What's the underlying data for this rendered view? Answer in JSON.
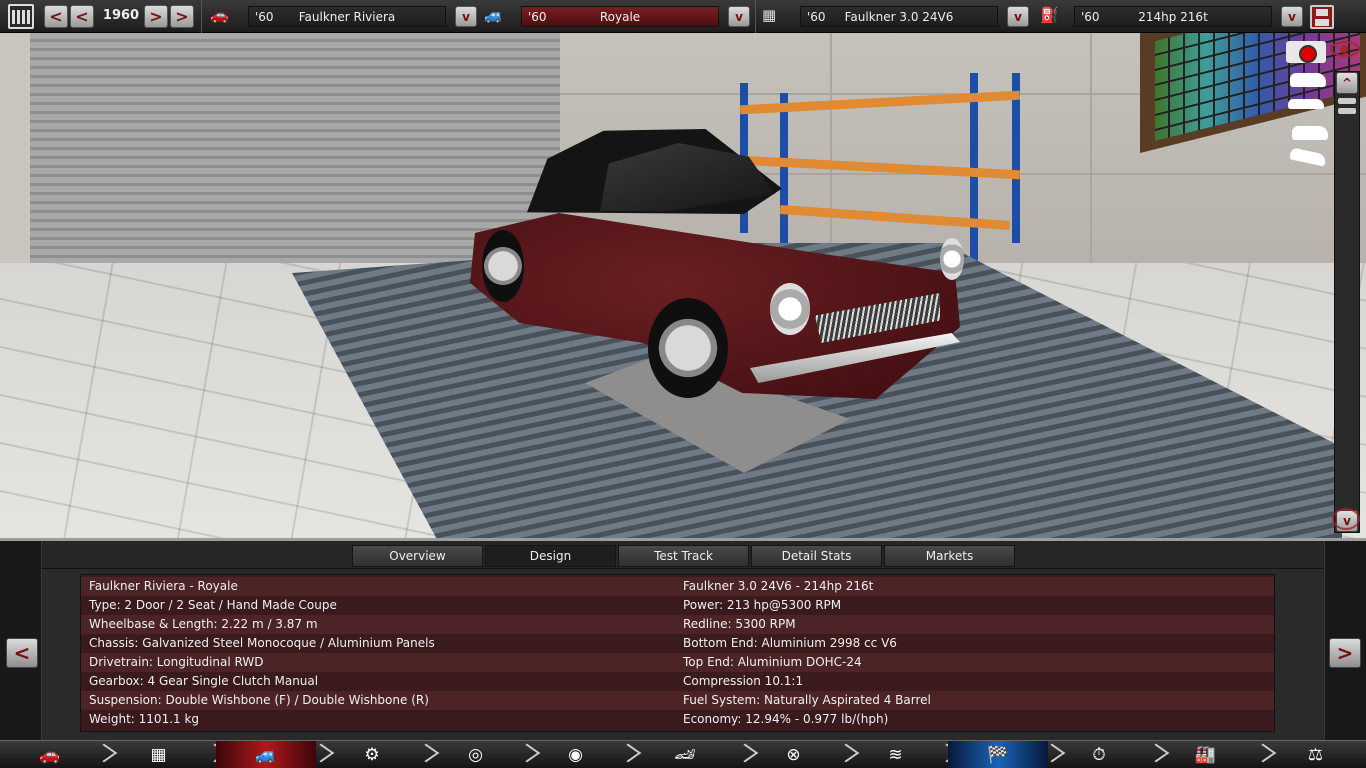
{
  "top": {
    "year": "1960",
    "prev2_label": "<",
    "prev_label": "<",
    "next_label": ">",
    "next2_label": ">",
    "dropdown_label": "v",
    "model": {
      "year": "'60",
      "name": "Faulkner Riviera"
    },
    "trim": {
      "year": "'60",
      "name": "Royale"
    },
    "engine_family": {
      "year": "'60",
      "name": "Faulkner 3.0 24V6"
    },
    "engine_variant": {
      "year": "'60",
      "name": "214hp 216t"
    }
  },
  "tabs": [
    {
      "label": "Overview"
    },
    {
      "label": "Design"
    },
    {
      "label": "Test Track"
    },
    {
      "label": "Detail Stats"
    },
    {
      "label": "Markets"
    }
  ],
  "active_tab": "Design",
  "page_prev_label": "<",
  "page_next_label": ">",
  "scroll": {
    "up": "^",
    "down": "v"
  },
  "info": {
    "left": [
      "Faulkner Riviera  - Royale",
      "Type: 2 Door / 2 Seat / Hand Made Coupe",
      "Wheelbase & Length: 2.22 m / 3.87 m",
      "Chassis: Galvanized Steel Monocoque / Aluminium Panels",
      "Drivetrain: Longitudinal RWD",
      "Gearbox: 4 Gear Single Clutch Manual",
      "Suspension: Double Wishbone (F) / Double Wishbone (R)",
      "Weight: 1101.1 kg"
    ],
    "right": [
      "Faulkner 3.0 24V6 - 214hp 216t",
      "Power: 213 hp@5300 RPM",
      "Redline: 5300 RPM",
      "Bottom End: Aluminium 2998 cc V6",
      "Top End: Aluminium DOHC-24",
      "Compression 10.1:1",
      "Fuel System: Naturally Aspirated 4 Barrel",
      "Economy: 12.94% - 0.977 lb/(hph)"
    ]
  },
  "nav": [
    {
      "name": "car-model-icon",
      "glyph": "🚗"
    },
    {
      "name": "chassis-icon",
      "glyph": "▦"
    },
    {
      "name": "trim-icon",
      "glyph": "🚙"
    },
    {
      "name": "gearbox-icon",
      "glyph": "⚙"
    },
    {
      "name": "wheels-icon",
      "glyph": "◎"
    },
    {
      "name": "body-icon",
      "glyph": "◉"
    },
    {
      "name": "aero-icon",
      "glyph": "🏎"
    },
    {
      "name": "interior-icon",
      "glyph": "⊗"
    },
    {
      "name": "suspension-icon",
      "glyph": "≋"
    },
    {
      "name": "test-track-icon",
      "glyph": "🏁"
    },
    {
      "name": "engineer-icon",
      "glyph": "⏱"
    },
    {
      "name": "factory-icon",
      "glyph": "🏭"
    },
    {
      "name": "market-scale-icon",
      "glyph": "⚖"
    }
  ],
  "colors": {
    "accent_red": "#b0181c",
    "accent_blue": "#1a63b8",
    "panel_row": "#4c2426"
  }
}
